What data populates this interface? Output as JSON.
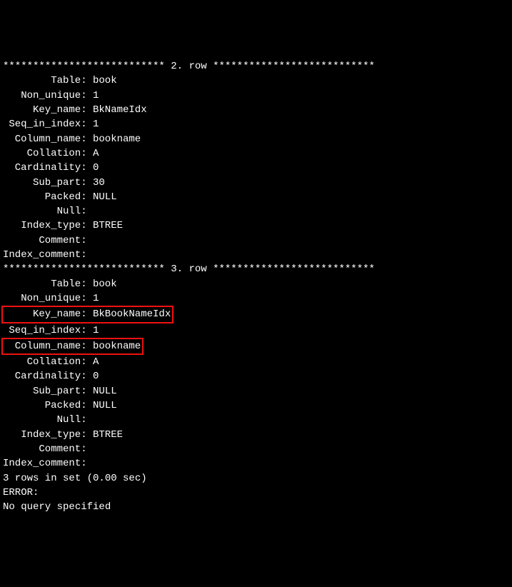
{
  "rows": [
    {
      "header_stars_left": "***************************",
      "header_label": " 2. row ",
      "header_stars_right": "***************************",
      "fields": [
        {
          "label": "Table",
          "value": "book",
          "hl": false
        },
        {
          "label": "Non_unique",
          "value": "1",
          "hl": false
        },
        {
          "label": "Key_name",
          "value": "BkNameIdx",
          "hl": false
        },
        {
          "label": "Seq_in_index",
          "value": "1",
          "hl": false
        },
        {
          "label": "Column_name",
          "value": "bookname",
          "hl": false
        },
        {
          "label": "Collation",
          "value": "A",
          "hl": false
        },
        {
          "label": "Cardinality",
          "value": "0",
          "hl": false
        },
        {
          "label": "Sub_part",
          "value": "30",
          "hl": false
        },
        {
          "label": "Packed",
          "value": "NULL",
          "hl": false
        },
        {
          "label": "Null",
          "value": "",
          "hl": false
        },
        {
          "label": "Index_type",
          "value": "BTREE",
          "hl": false
        },
        {
          "label": "Comment",
          "value": "",
          "hl": false
        },
        {
          "label": "Index_comment",
          "value": "",
          "hl": false
        }
      ]
    },
    {
      "header_stars_left": "***************************",
      "header_label": " 3. row ",
      "header_stars_right": "***************************",
      "fields": [
        {
          "label": "Table",
          "value": "book",
          "hl": false
        },
        {
          "label": "Non_unique",
          "value": "1",
          "hl": false
        },
        {
          "label": "Key_name",
          "value": "BkBookNameIdx",
          "hl": true
        },
        {
          "label": "Seq_in_index",
          "value": "1",
          "hl": false
        },
        {
          "label": "Column_name",
          "value": "bookname",
          "hl": true
        },
        {
          "label": "Collation",
          "value": "A",
          "hl": false
        },
        {
          "label": "Cardinality",
          "value": "0",
          "hl": false
        },
        {
          "label": "Sub_part",
          "value": "NULL",
          "hl": false
        },
        {
          "label": "Packed",
          "value": "NULL",
          "hl": false
        },
        {
          "label": "Null",
          "value": "",
          "hl": false
        },
        {
          "label": "Index_type",
          "value": "BTREE",
          "hl": false
        },
        {
          "label": "Comment",
          "value": "",
          "hl": false
        },
        {
          "label": "Index_comment",
          "value": "",
          "hl": false
        }
      ]
    }
  ],
  "footer_lines": [
    "3 rows in set (0.00 sec)",
    "",
    "ERROR:",
    "No query specified"
  ]
}
